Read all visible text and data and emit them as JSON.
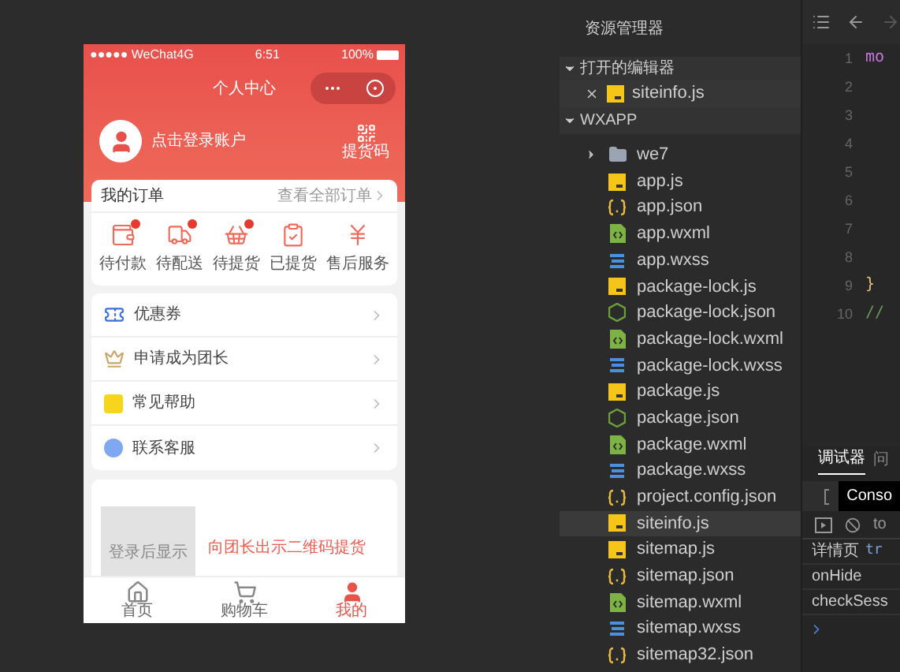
{
  "phone": {
    "status_bar": {
      "carrier": "●●●●● WeChat4G",
      "time": "6:51",
      "battery": "100%"
    },
    "nav": {
      "title": "个人中心"
    },
    "profile": {
      "login": "点击登录账户",
      "qr_label": "提货码"
    },
    "orders": {
      "title": "我的订单",
      "link": "查看全部订单",
      "items": [
        {
          "label": "待付款",
          "kind": "wallet",
          "badge": true
        },
        {
          "label": "待配送",
          "kind": "truck",
          "badge": true
        },
        {
          "label": "待提货",
          "kind": "basket",
          "badge": true
        },
        {
          "label": "已提货",
          "kind": "check",
          "badge": false
        },
        {
          "label": "售后服务",
          "kind": "yen",
          "badge": false
        }
      ]
    },
    "menu": [
      {
        "label": "优惠券",
        "kind": "coupon"
      },
      {
        "label": "申请成为团长",
        "kind": "crown"
      },
      {
        "label": "常见帮助",
        "kind": "help"
      },
      {
        "label": "联系客服",
        "kind": "service"
      }
    ],
    "pickup": {
      "qr_placeholder": "登录后显示",
      "hint": "向团长出示二维码提货"
    },
    "tabbar": [
      {
        "label": "首页",
        "kind": "home",
        "selected": false
      },
      {
        "label": "购物车",
        "kind": "cart",
        "selected": false
      },
      {
        "label": "我的",
        "kind": "user",
        "selected": true
      }
    ]
  },
  "explorer": {
    "title": "资源管理器",
    "open_editors": {
      "title": "打开的编辑器",
      "expanded": true,
      "files": [
        {
          "name": "siteinfo.js",
          "kind": "js"
        }
      ]
    },
    "project": {
      "title": "WXAPP",
      "expanded": true,
      "files": [
        {
          "name": "we7",
          "kind": "folder",
          "expanded": false,
          "selected": false
        },
        {
          "name": "app.js",
          "kind": "js",
          "selected": false
        },
        {
          "name": "app.json",
          "kind": "json",
          "selected": false
        },
        {
          "name": "app.wxml",
          "kind": "wxml",
          "selected": false
        },
        {
          "name": "app.wxss",
          "kind": "wxss",
          "selected": false
        },
        {
          "name": "package-lock.js",
          "kind": "js",
          "selected": false
        },
        {
          "name": "package-lock.json",
          "kind": "npm",
          "selected": false
        },
        {
          "name": "package-lock.wxml",
          "kind": "wxml",
          "selected": false
        },
        {
          "name": "package-lock.wxss",
          "kind": "wxss",
          "selected": false
        },
        {
          "name": "package.js",
          "kind": "js",
          "selected": false
        },
        {
          "name": "package.json",
          "kind": "npm",
          "selected": false
        },
        {
          "name": "package.wxml",
          "kind": "wxml",
          "selected": false
        },
        {
          "name": "package.wxss",
          "kind": "wxss",
          "selected": false
        },
        {
          "name": "project.config.json",
          "kind": "json",
          "selected": false
        },
        {
          "name": "siteinfo.js",
          "kind": "js",
          "selected": true
        },
        {
          "name": "sitemap.js",
          "kind": "js",
          "selected": false
        },
        {
          "name": "sitemap.json",
          "kind": "json",
          "selected": false
        },
        {
          "name": "sitemap.wxml",
          "kind": "wxml",
          "selected": false
        },
        {
          "name": "sitemap.wxss",
          "kind": "wxss",
          "selected": false
        },
        {
          "name": "sitemap32.json",
          "kind": "json",
          "selected": false
        }
      ]
    }
  },
  "editor": {
    "lines": [
      {
        "number": "1",
        "code": {
          "text": "mo",
          "kind": "keyword"
        }
      },
      {
        "number": "2"
      },
      {
        "number": "3"
      },
      {
        "number": "4"
      },
      {
        "number": "5"
      },
      {
        "number": "6"
      },
      {
        "number": "7"
      },
      {
        "number": "8"
      },
      {
        "number": "9",
        "code": {
          "text": "}",
          "kind": "brace"
        }
      },
      {
        "number": "10",
        "code": {
          "text": "//",
          "kind": "comment"
        }
      }
    ]
  },
  "debugger": {
    "tabs": [
      {
        "label": "调试器",
        "selected": true
      },
      {
        "label": "问",
        "selected": false
      }
    ],
    "console_tab": "Conso",
    "filter": "to",
    "logs": [
      {
        "text": "详情页",
        "value": "tr"
      },
      {
        "text": "onHide"
      },
      {
        "text": "checkSess"
      }
    ]
  }
}
